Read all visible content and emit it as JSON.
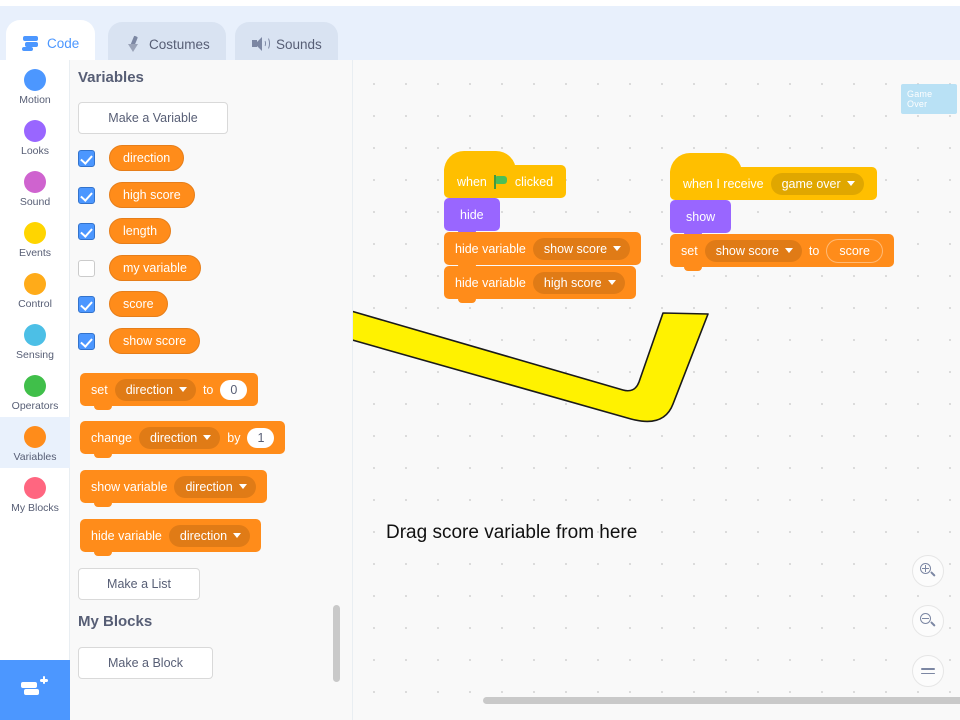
{
  "tabs": [
    {
      "label": "Code",
      "icon": "code-icon",
      "active": true
    },
    {
      "label": "Costumes",
      "icon": "brush-icon",
      "active": false
    },
    {
      "label": "Sounds",
      "icon": "speaker-icon",
      "active": false
    }
  ],
  "categories": [
    {
      "label": "Motion",
      "color": "#4C97FF",
      "selected": false
    },
    {
      "label": "Looks",
      "color": "#9966FF",
      "selected": false
    },
    {
      "label": "Sound",
      "color": "#CF63CF",
      "selected": false
    },
    {
      "label": "Events",
      "color": "#FFD500",
      "selected": false
    },
    {
      "label": "Control",
      "color": "#FFAB19",
      "selected": false
    },
    {
      "label": "Sensing",
      "color": "#4CBFE6",
      "selected": false
    },
    {
      "label": "Operators",
      "color": "#40BF4A",
      "selected": false
    },
    {
      "label": "Variables",
      "color": "#FF8C1A",
      "selected": true
    },
    {
      "label": "My Blocks",
      "color": "#FF6680",
      "selected": false
    }
  ],
  "palette": {
    "section_title": "Variables",
    "make_variable_label": "Make a Variable",
    "make_list_label": "Make a List",
    "my_blocks_title": "My Blocks",
    "make_block_label": "Make a Block",
    "variables": [
      {
        "name": "direction",
        "checked": true
      },
      {
        "name": "high score",
        "checked": true
      },
      {
        "name": "length",
        "checked": true
      },
      {
        "name": "my variable",
        "checked": false
      },
      {
        "name": "score",
        "checked": true
      },
      {
        "name": "show score",
        "checked": true
      }
    ],
    "blocks": {
      "set_label": "set",
      "set_var": "direction",
      "set_to": "to",
      "set_value": "0",
      "change_label": "change",
      "change_var": "direction",
      "change_by": "by",
      "change_value": "1",
      "show_variable_label": "show variable",
      "show_variable_var": "direction",
      "hide_variable_label": "hide variable",
      "hide_variable_var": "direction"
    }
  },
  "workspace": {
    "script_left": {
      "hat_when": "when",
      "hat_clicked": "clicked",
      "hide": "hide",
      "hide_var_1_label": "hide variable",
      "hide_var_1_value": "show score",
      "hide_var_2_label": "hide variable",
      "hide_var_2_value": "high score"
    },
    "script_right": {
      "hat_when_receive": "when I receive",
      "hat_message": "game over",
      "show": "show",
      "set_label": "set",
      "set_var": "show score",
      "set_to": "to",
      "set_reporter": "score"
    },
    "stage_chip": "Game Over",
    "annotation": "Drag score variable from here",
    "zoom_controls": [
      {
        "name": "zoom-in",
        "glyph": "magnifier-plus"
      },
      {
        "name": "zoom-out",
        "glyph": "magnifier-minus"
      },
      {
        "name": "zoom-reset",
        "glyph": "equals"
      }
    ]
  },
  "colors": {
    "variables_orange": "#FF8C1A",
    "events_yellow": "#FFBF00",
    "looks_purple": "#9966FF",
    "accent_blue": "#4C97FF",
    "arrow_yellow": "#FFF200"
  }
}
